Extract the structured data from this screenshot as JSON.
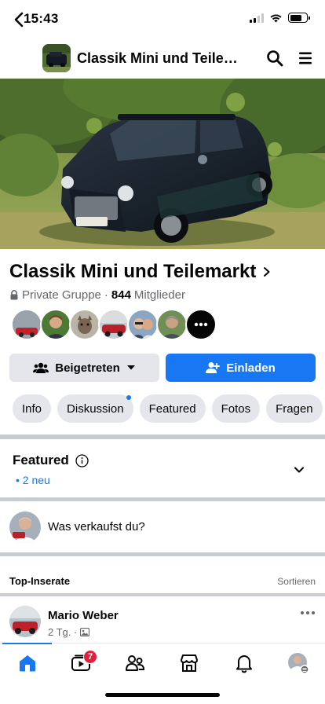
{
  "status_bar": {
    "time": "15:43"
  },
  "nav": {
    "title": "Classik Mini und Teilema...",
    "icons": [
      "back-arrow-icon",
      "search-icon",
      "menu-icon"
    ]
  },
  "group": {
    "name": "Classik Mini und Teilemarkt",
    "privacy": "Private Gruppe",
    "separator": "·",
    "member_count": "844",
    "members_label": "Mitglieder"
  },
  "actions": {
    "joined_label": "Beigetreten",
    "invite_label": "Einladen"
  },
  "tabs": [
    {
      "label": "Info"
    },
    {
      "label": "Diskussion",
      "has_new": true
    },
    {
      "label": "Featured"
    },
    {
      "label": "Fotos"
    },
    {
      "label": "Fragen"
    }
  ],
  "featured": {
    "title": "Featured",
    "new_count": "• 2 neu"
  },
  "composer": {
    "prompt": "Was verkaufst du?"
  },
  "top_listings": {
    "title": "Top-Inserate",
    "sort_label": "Sortieren"
  },
  "post": {
    "author": "Mario Weber",
    "time": "2 Tg. ·"
  },
  "bottom_nav": {
    "items": [
      "home-icon",
      "video-icon",
      "groups-icon",
      "marketplace-icon",
      "notifications-icon",
      "profile-avatar"
    ],
    "video_badge": "7"
  },
  "colors": {
    "accent": "#1877f2",
    "badge": "#e41e3f",
    "secondary_text": "#65676b",
    "button_gray": "#e4e6eb"
  }
}
